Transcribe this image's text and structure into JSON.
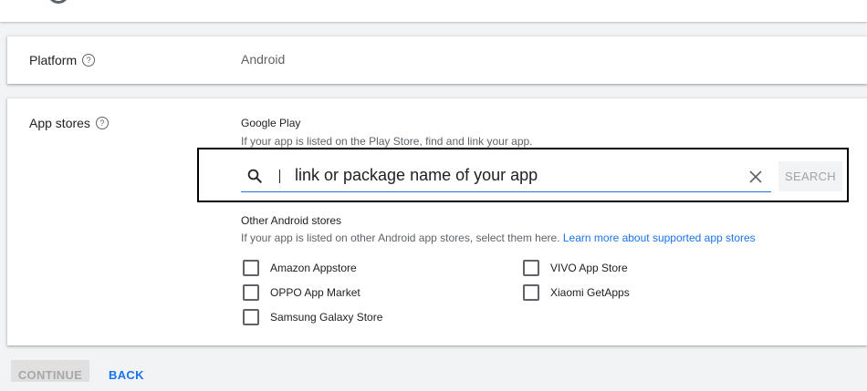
{
  "platform": {
    "label": "Platform",
    "value": "Android"
  },
  "app_stores": {
    "label": "App stores",
    "google_play": {
      "title": "Google Play",
      "description": "If your app is listed on the Play Store, find and link your app.",
      "search": {
        "value": "link or package name of your app",
        "button_label": "SEARCH"
      }
    },
    "other_stores": {
      "title": "Other Android stores",
      "description": "If your app is listed on other Android app stores, select them here.",
      "learn_more": "Learn more about supported app stores",
      "items": [
        {
          "label": "Amazon Appstore",
          "checked": false
        },
        {
          "label": "OPPO App Market",
          "checked": false
        },
        {
          "label": "Samsung Galaxy Store",
          "checked": false
        },
        {
          "label": "VIVO App Store",
          "checked": false
        },
        {
          "label": "Xiaomi GetApps",
          "checked": false
        }
      ]
    }
  },
  "footer": {
    "continue_label": "CONTINUE",
    "back_label": "BACK"
  },
  "colors": {
    "accent": "#1a73e8",
    "text": "#202124",
    "muted": "#5f6368",
    "highlight_border": "#000000"
  }
}
